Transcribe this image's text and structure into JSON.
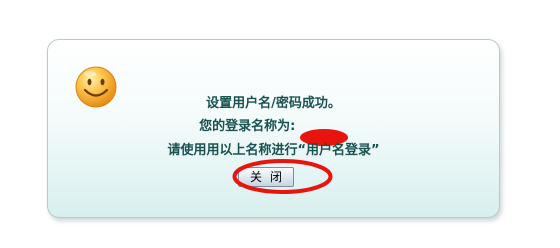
{
  "dialog": {
    "line1": "设置用户名/密码成功。",
    "line2_prefix": "您的登录名称为:",
    "line3": "请使用用以上名称进行“用户名登录”",
    "close_button_label": "关闭"
  },
  "colors": {
    "message_text": "#1a5252",
    "annotation_red": "#e8140e",
    "smiley_yellow": "#f7b02a"
  },
  "icons": {
    "success": "smiley-face-icon"
  }
}
